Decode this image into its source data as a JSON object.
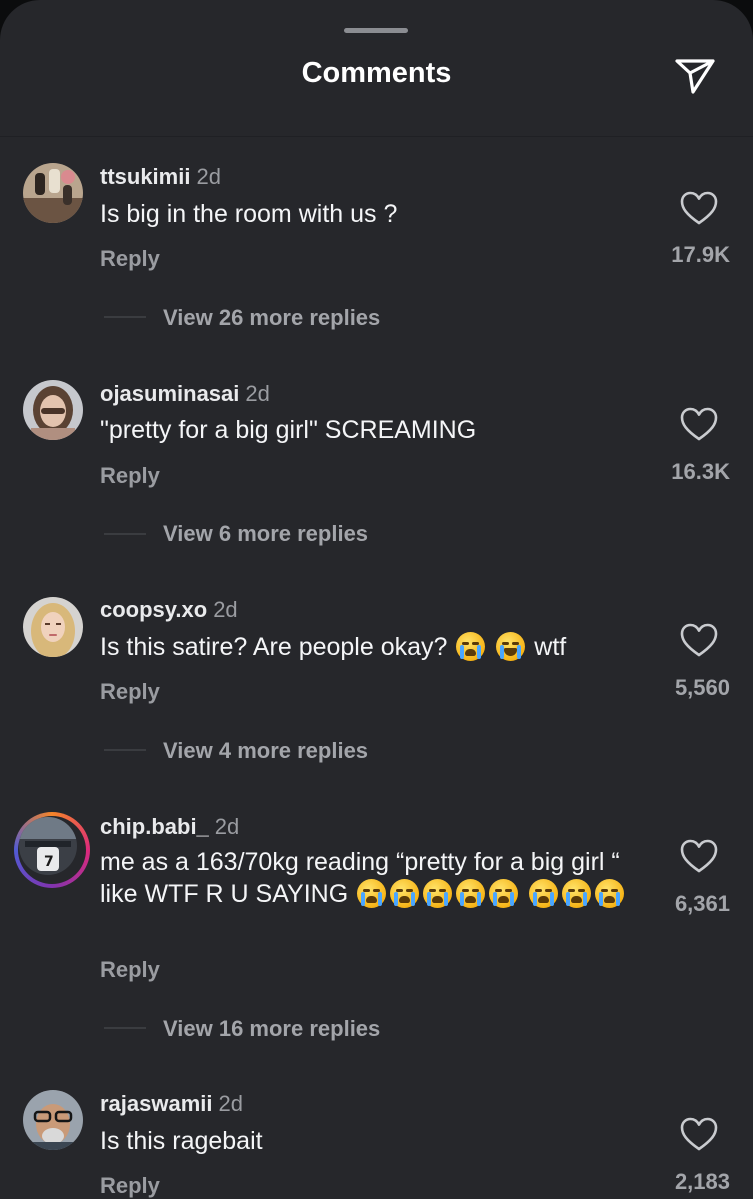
{
  "header": {
    "title": "Comments",
    "share_icon": "send-icon"
  },
  "colors": {
    "sheet_bg": "#26272b",
    "text_primary": "#f4f5f7",
    "text_secondary": "#9a9ca1",
    "story_ring": "#dd2a7b"
  },
  "comments": [
    {
      "username": "ttsukimii",
      "time": "2d",
      "text": "Is big in the room with us ?",
      "reply_label": "Reply",
      "likes": "17.9K",
      "view_more": "View 26 more replies"
    },
    {
      "username": "ojasuminasai",
      "time": "2d",
      "text": "\"pretty for a big girl\" SCREAMING",
      "reply_label": "Reply",
      "likes": "16.3K",
      "view_more": "View 6 more replies"
    },
    {
      "username": "coopsy.xo",
      "time": "2d",
      "text": "Is this satire? Are people okay?",
      "text_end": "wtf",
      "reply_label": "Reply",
      "likes": "5,560",
      "view_more": "View 4 more replies"
    },
    {
      "username": "chip.babi_",
      "time": "2d",
      "text": "me as a 163/70kg reading “pretty for a big girl “ like WTF R U SAYING",
      "reply_label": "Reply",
      "likes": "6,361",
      "view_more": "View 16 more replies"
    },
    {
      "username": "rajaswamii",
      "time": "2d",
      "text": "Is this ragebait",
      "reply_label": "Reply",
      "likes": "2,183"
    }
  ]
}
